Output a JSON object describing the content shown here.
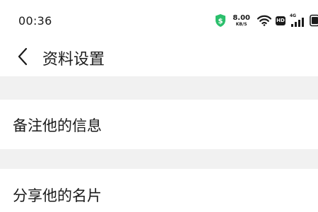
{
  "status_bar": {
    "time": "00:36",
    "net_speed_value": "8.00",
    "net_speed_unit": "KB/S",
    "hd_label": "HD",
    "network_type": "4G",
    "icons": [
      "shield-icon",
      "wifi-icon",
      "hd-icon",
      "signal-icon",
      "battery-icon"
    ],
    "shield_color": "#2bbf6c"
  },
  "header": {
    "back_icon": "chevron-left-icon",
    "title": "资料设置"
  },
  "menu": {
    "items": [
      {
        "label": "备注他的信息"
      },
      {
        "label": "分享他的名片"
      }
    ]
  },
  "colors": {
    "background": "#ffffff",
    "section_gap": "#f1f1f1",
    "text": "#1a1a1a"
  }
}
